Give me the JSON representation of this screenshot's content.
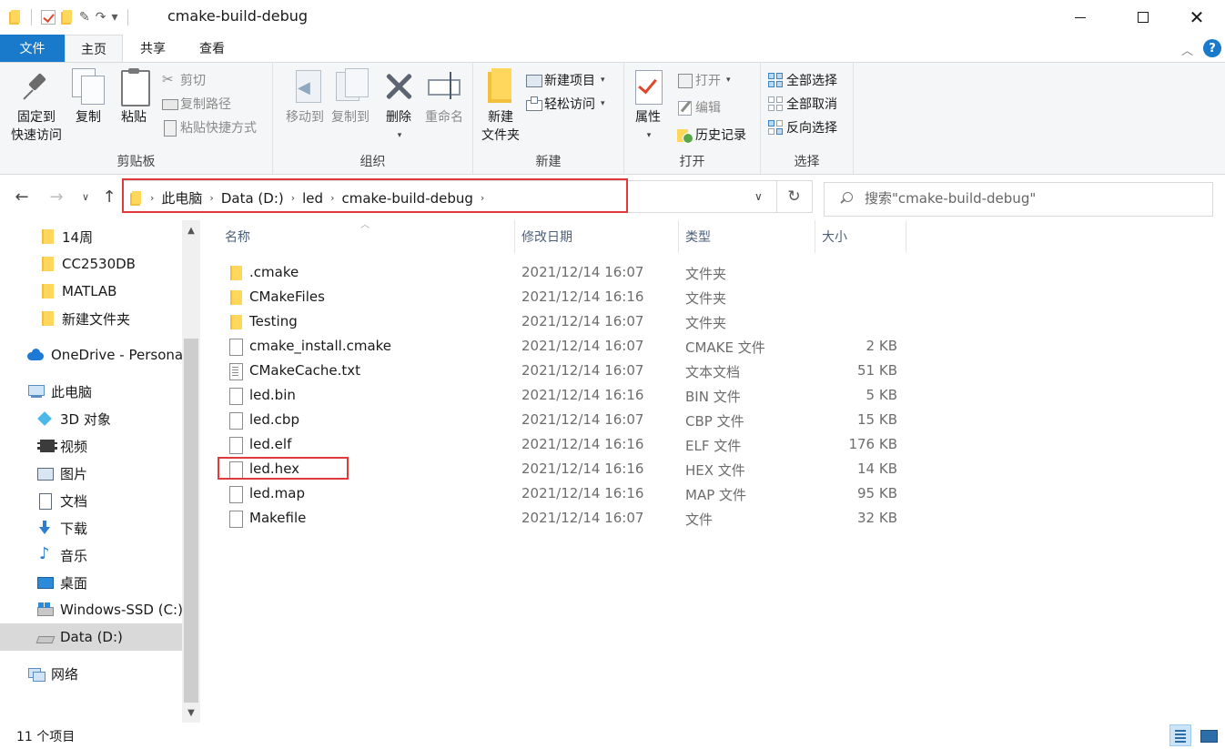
{
  "window": {
    "title": "cmake-build-debug"
  },
  "ribbon": {
    "tabs": {
      "file": "文件",
      "home": "主页",
      "share": "共享",
      "view": "查看"
    },
    "clipboard": {
      "label": "剪贴板",
      "pin_line1": "固定到",
      "pin_line2": "快速访问",
      "copy": "复制",
      "paste": "粘贴",
      "cut": "剪切",
      "copy_path": "复制路径",
      "paste_shortcut": "粘贴快捷方式"
    },
    "organize": {
      "label": "组织",
      "move_to": "移动到",
      "copy_to": "复制到",
      "delete": "删除",
      "rename": "重命名"
    },
    "new": {
      "label": "新建",
      "new_folder_line1": "新建",
      "new_folder_line2": "文件夹",
      "new_item": "新建项目",
      "easy_access": "轻松访问"
    },
    "open": {
      "label": "打开",
      "properties": "属性",
      "open": "打开",
      "edit": "编辑",
      "history": "历史记录"
    },
    "select": {
      "label": "选择",
      "select_all": "全部选择",
      "select_none": "全部取消",
      "invert": "反向选择"
    }
  },
  "address": {
    "crumbs": [
      "此电脑",
      "Data (D:)",
      "led",
      "cmake-build-debug"
    ]
  },
  "search": {
    "placeholder": "搜索\"cmake-build-debug\""
  },
  "nav_pane": {
    "items": [
      {
        "label": "14周",
        "icon": "folder-icon"
      },
      {
        "label": "CC2530DB",
        "icon": "folder-icon"
      },
      {
        "label": "MATLAB",
        "icon": "folder-icon"
      },
      {
        "label": "新建文件夹",
        "icon": "folder-icon"
      },
      {
        "label": "OneDrive - Personal",
        "icon": "onedrive-icon"
      },
      {
        "label": "此电脑",
        "icon": "this-pc-icon"
      },
      {
        "label": "3D 对象",
        "icon": "3d-objects-icon"
      },
      {
        "label": "视频",
        "icon": "video-icon"
      },
      {
        "label": "图片",
        "icon": "pictures-icon"
      },
      {
        "label": "文档",
        "icon": "documents-icon"
      },
      {
        "label": "下载",
        "icon": "downloads-icon"
      },
      {
        "label": "音乐",
        "icon": "music-icon"
      },
      {
        "label": "桌面",
        "icon": "desktop-icon"
      },
      {
        "label": "Windows-SSD (C:)",
        "icon": "windows-drive-icon"
      },
      {
        "label": "Data (D:)",
        "icon": "drive-icon"
      },
      {
        "label": "网络",
        "icon": "network-icon"
      }
    ]
  },
  "file_list": {
    "columns": {
      "name": "名称",
      "date": "修改日期",
      "type": "类型",
      "size": "大小"
    },
    "rows": [
      {
        "name": ".cmake",
        "date": "2021/12/14 16:07",
        "type": "文件夹",
        "size": "",
        "icon": "folder-icon"
      },
      {
        "name": "CMakeFiles",
        "date": "2021/12/14 16:16",
        "type": "文件夹",
        "size": "",
        "icon": "folder-icon"
      },
      {
        "name": "Testing",
        "date": "2021/12/14 16:07",
        "type": "文件夹",
        "size": "",
        "icon": "folder-icon"
      },
      {
        "name": "cmake_install.cmake",
        "date": "2021/12/14 16:07",
        "type": "CMAKE 文件",
        "size": "2 KB",
        "icon": "file-icon"
      },
      {
        "name": "CMakeCache.txt",
        "date": "2021/12/14 16:07",
        "type": "文本文档",
        "size": "51 KB",
        "icon": "text-file-icon"
      },
      {
        "name": "led.bin",
        "date": "2021/12/14 16:16",
        "type": "BIN 文件",
        "size": "5 KB",
        "icon": "file-icon"
      },
      {
        "name": "led.cbp",
        "date": "2021/12/14 16:07",
        "type": "CBP 文件",
        "size": "15 KB",
        "icon": "file-icon"
      },
      {
        "name": "led.elf",
        "date": "2021/12/14 16:16",
        "type": "ELF 文件",
        "size": "176 KB",
        "icon": "file-icon"
      },
      {
        "name": "led.hex",
        "date": "2021/12/14 16:16",
        "type": "HEX 文件",
        "size": "14 KB",
        "icon": "file-icon"
      },
      {
        "name": "led.map",
        "date": "2021/12/14 16:16",
        "type": "MAP 文件",
        "size": "95 KB",
        "icon": "file-icon"
      },
      {
        "name": "Makefile",
        "date": "2021/12/14 16:07",
        "type": "文件",
        "size": "32 KB",
        "icon": "file-icon"
      }
    ]
  },
  "status": {
    "count": "11 个项目"
  },
  "colors": {
    "file_tab": "#1979ca",
    "highlight_box": "#e03a3a",
    "folder": "#ffd75c"
  }
}
